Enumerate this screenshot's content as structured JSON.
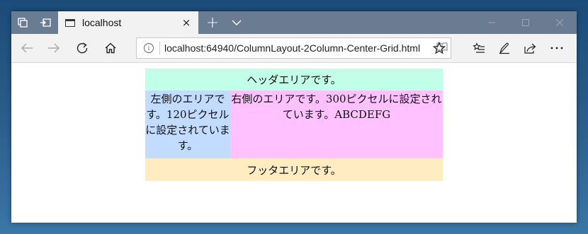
{
  "browser": {
    "tab_title": "localhost",
    "tab_close_glyph": "×",
    "new_tab_glyph": "+",
    "tab_list_glyph": "⌄",
    "url": "localhost:64940/ColumnLayout-2Column-Center-Grid.html",
    "icons": {
      "set_aside": "tabs-aside-icon",
      "show_aside": "tabs-show-icon",
      "back": "back-arrow-icon",
      "forward": "forward-arrow-icon",
      "refresh": "refresh-icon",
      "home": "home-icon",
      "info": "site-info-icon",
      "reading_view": "reading-view-icon",
      "favorite": "favorite-star-icon",
      "favorites_list": "favorites-list-icon",
      "notes": "web-note-pen-icon",
      "share": "share-icon",
      "more": "more-dots-icon"
    }
  },
  "page": {
    "header_text": "ヘッダエリアです。",
    "left_text": "左側のエリアです。120ピクセルに設定されています。",
    "right_text": "右側のエリアです。300ピクセルに設定されています。ABCDEFG",
    "footer_text": "フッタエリアです。"
  },
  "colors": {
    "header_bg": "#c1ffe8",
    "left_bg": "#c1dcff",
    "right_bg": "#ffc1ff",
    "footer_bg": "#ffedc1",
    "titlebar_bg": "#697c91"
  }
}
